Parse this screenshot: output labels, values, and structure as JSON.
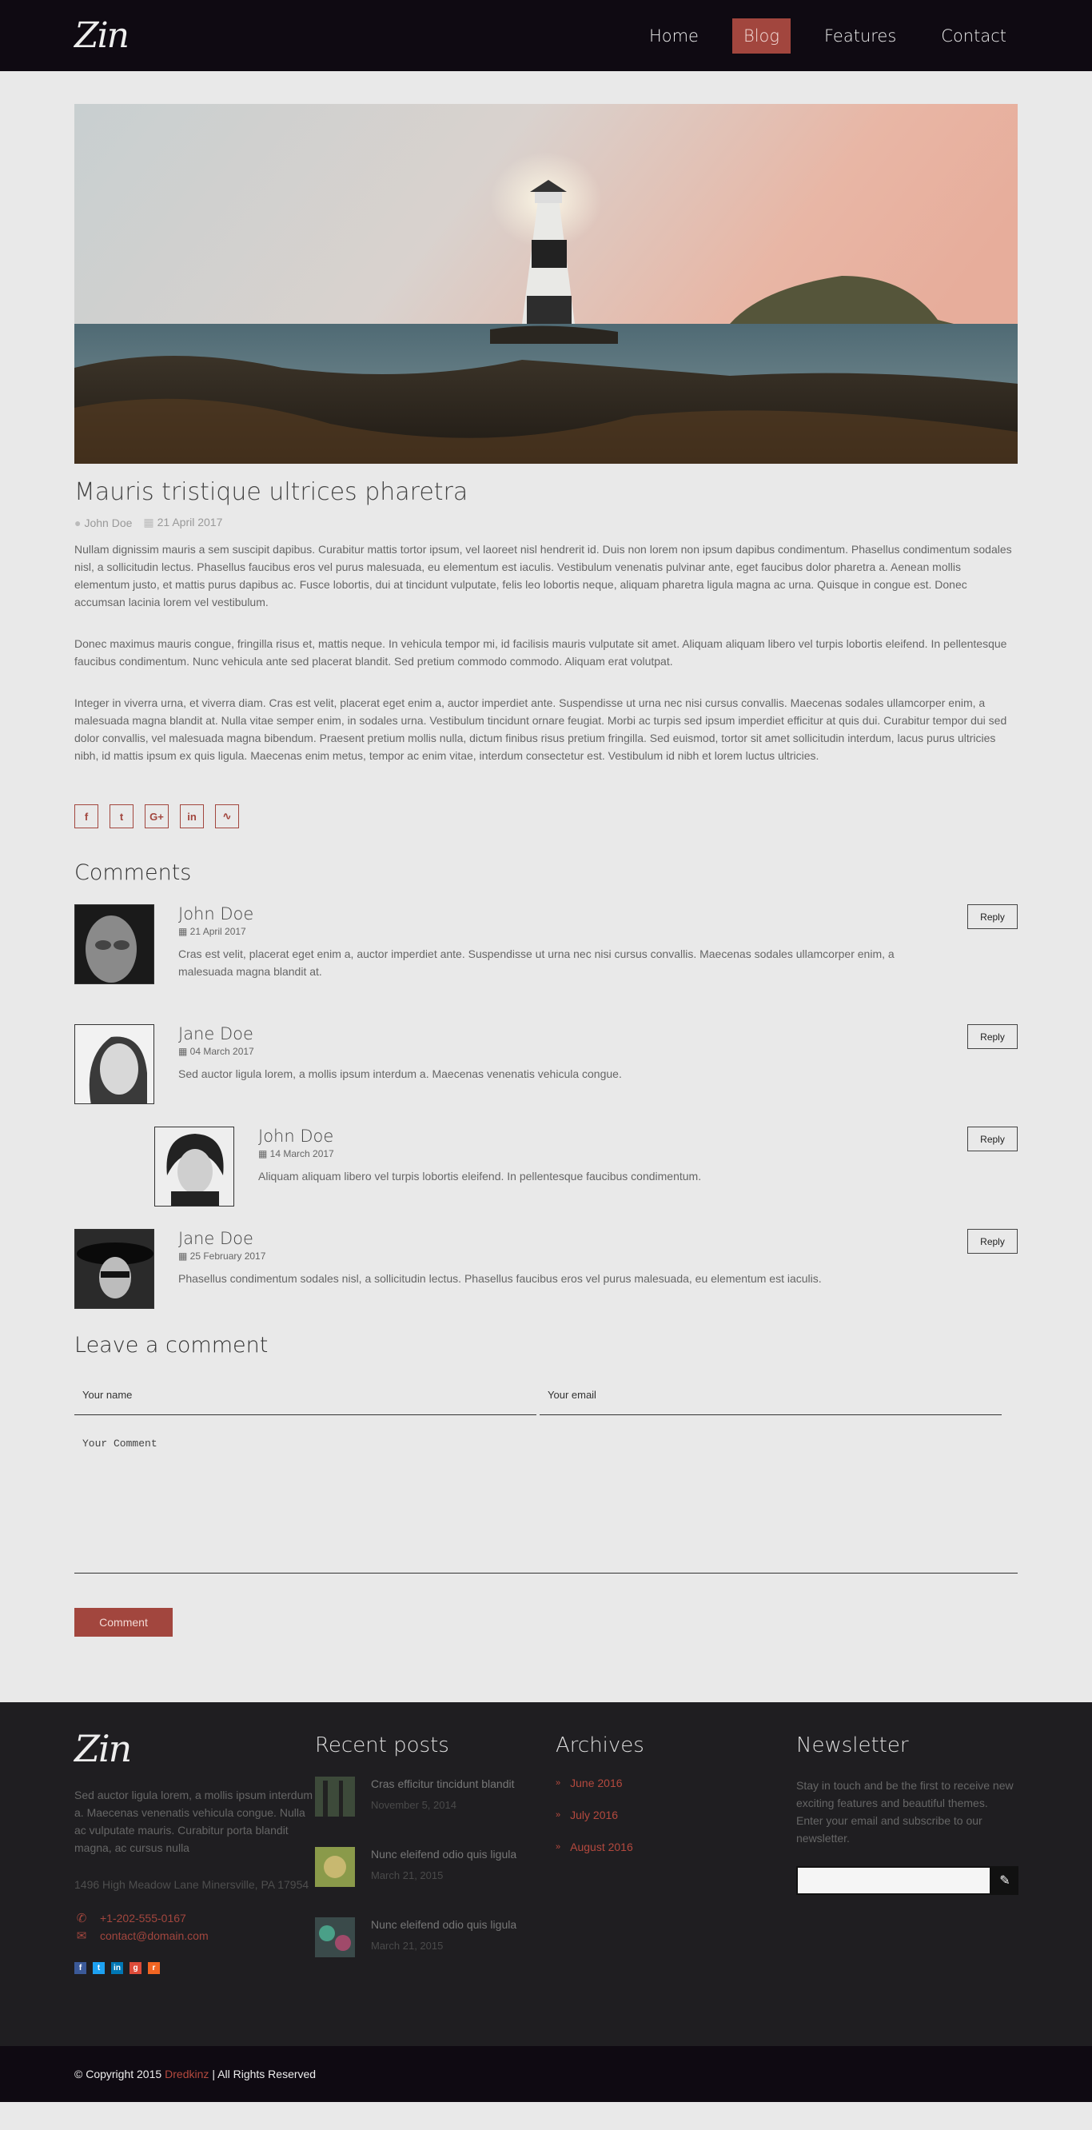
{
  "header": {
    "logo": "Zin",
    "nav": [
      "Home",
      "Blog",
      "Features",
      "Contact"
    ]
  },
  "post": {
    "title": "Mauris tristique ultrices pharetra",
    "author": "John Doe",
    "date": "21 April 2017",
    "paragraphs": [
      "Nullam dignissim mauris a sem suscipit dapibus. Curabitur mattis tortor ipsum, vel laoreet nisl hendrerit id. Duis non lorem non ipsum dapibus condimentum. Phasellus condimentum sodales nisl, a sollicitudin lectus. Phasellus faucibus eros vel purus malesuada, eu elementum est iaculis. Vestibulum venenatis pulvinar ante, eget faucibus dolor pharetra a. Aenean mollis elementum justo, et mattis purus dapibus ac. Fusce lobortis, dui at tincidunt vulputate, felis leo lobortis neque, aliquam pharetra ligula magna ac urna. Quisque in congue est. Donec accumsan lacinia lorem vel vestibulum.",
      "Donec maximus mauris congue, fringilla risus et, mattis neque. In vehicula tempor mi, id facilisis mauris vulputate sit amet. Aliquam aliquam libero vel turpis lobortis eleifend. In pellentesque faucibus condimentum. Nunc vehicula ante sed placerat blandit. Sed pretium commodo commodo. Aliquam erat volutpat.",
      "Integer in viverra urna, et viverra diam. Cras est velit, placerat eget enim a, auctor imperdiet ante. Suspendisse ut urna nec nisi cursus convallis. Maecenas sodales ullamcorper enim, a malesuada magna blandit at. Nulla vitae semper enim, in sodales urna. Vestibulum tincidunt ornare feugiat. Morbi ac turpis sed ipsum imperdiet efficitur at quis dui. Curabitur tempor dui sed dolor convallis, vel malesuada magna bibendum. Praesent pretium mollis nulla, dictum finibus risus pretium fringilla. Sed euismod, tortor sit amet sollicitudin interdum, lacus purus ultricies nibh, id mattis ipsum ex quis ligula. Maecenas enim metus, tempor ac enim vitae, interdum consectetur est. Vestibulum id nibh et lorem luctus ultricies."
    ],
    "share_icons": [
      "f",
      "t",
      "G+",
      "in",
      "rss"
    ]
  },
  "comments": {
    "title": "Comments",
    "reply_label": "Reply",
    "items": [
      {
        "name": "John Doe",
        "date": "21 April 2017",
        "text": "Cras est velit, placerat eget enim a, auctor imperdiet ante. Suspendisse ut urna nec nisi cursus convallis. Maecenas sodales ullamcorper enim, a malesuada magna blandit at."
      },
      {
        "name": "Jane Doe",
        "date": "04 March 2017",
        "text": "Sed auctor ligula lorem, a mollis ipsum interdum a. Maecenas venenatis vehicula congue."
      },
      {
        "name": "John Doe",
        "date": "14 March 2017",
        "text": "Aliquam aliquam libero vel turpis lobortis eleifend. In pellentesque faucibus condimentum."
      },
      {
        "name": "Jane Doe",
        "date": "25 February 2017",
        "text": "Phasellus condimentum sodales nisl, a sollicitudin lectus. Phasellus faucibus eros vel purus malesuada, eu elementum est iaculis."
      }
    ]
  },
  "form": {
    "title": "Leave a comment",
    "name_placeholder": "Your name",
    "email_placeholder": "Your email",
    "comment_placeholder": "Your Comment",
    "submit_label": "Comment"
  },
  "footer": {
    "logo": "Zin",
    "about": "Sed auctor ligula lorem, a mollis ipsum interdum a. Maecenas venenatis vehicula congue. Nulla ac vulputate mauris. Curabitur porta blandit magna, ac cursus nulla",
    "address": "1496 High Meadow Lane Minersville, PA 17954",
    "phone": "+1-202-555-0167",
    "email": "contact@domain.com",
    "recent_title": "Recent posts",
    "recent_posts": [
      {
        "title": "Cras efficitur tincidunt blandit",
        "date": "November 5, 2014"
      },
      {
        "title": "Nunc eleifend odio quis ligula",
        "date": "March 21, 2015"
      },
      {
        "title": "Nunc eleifend odio quis ligula",
        "date": "March 21, 2015"
      }
    ],
    "archives_title": "Archives",
    "archives": [
      "June 2016",
      "July 2016",
      "August 2016"
    ],
    "newsletter_title": "Newsletter",
    "newsletter_text": "Stay in touch and be the first to receive new exciting features and beautiful themes. Enter your email and subscribe to our newsletter."
  },
  "copyright": {
    "prefix": "© Copyright 2015",
    "brand": "Dredkinz",
    "suffix": "| All Rights Reserved"
  },
  "colors": {
    "accent": "#a2463e",
    "header_bg": "#0f0a12",
    "footer_bg": "#1f1e21",
    "page_bg": "#e9e9e9"
  }
}
